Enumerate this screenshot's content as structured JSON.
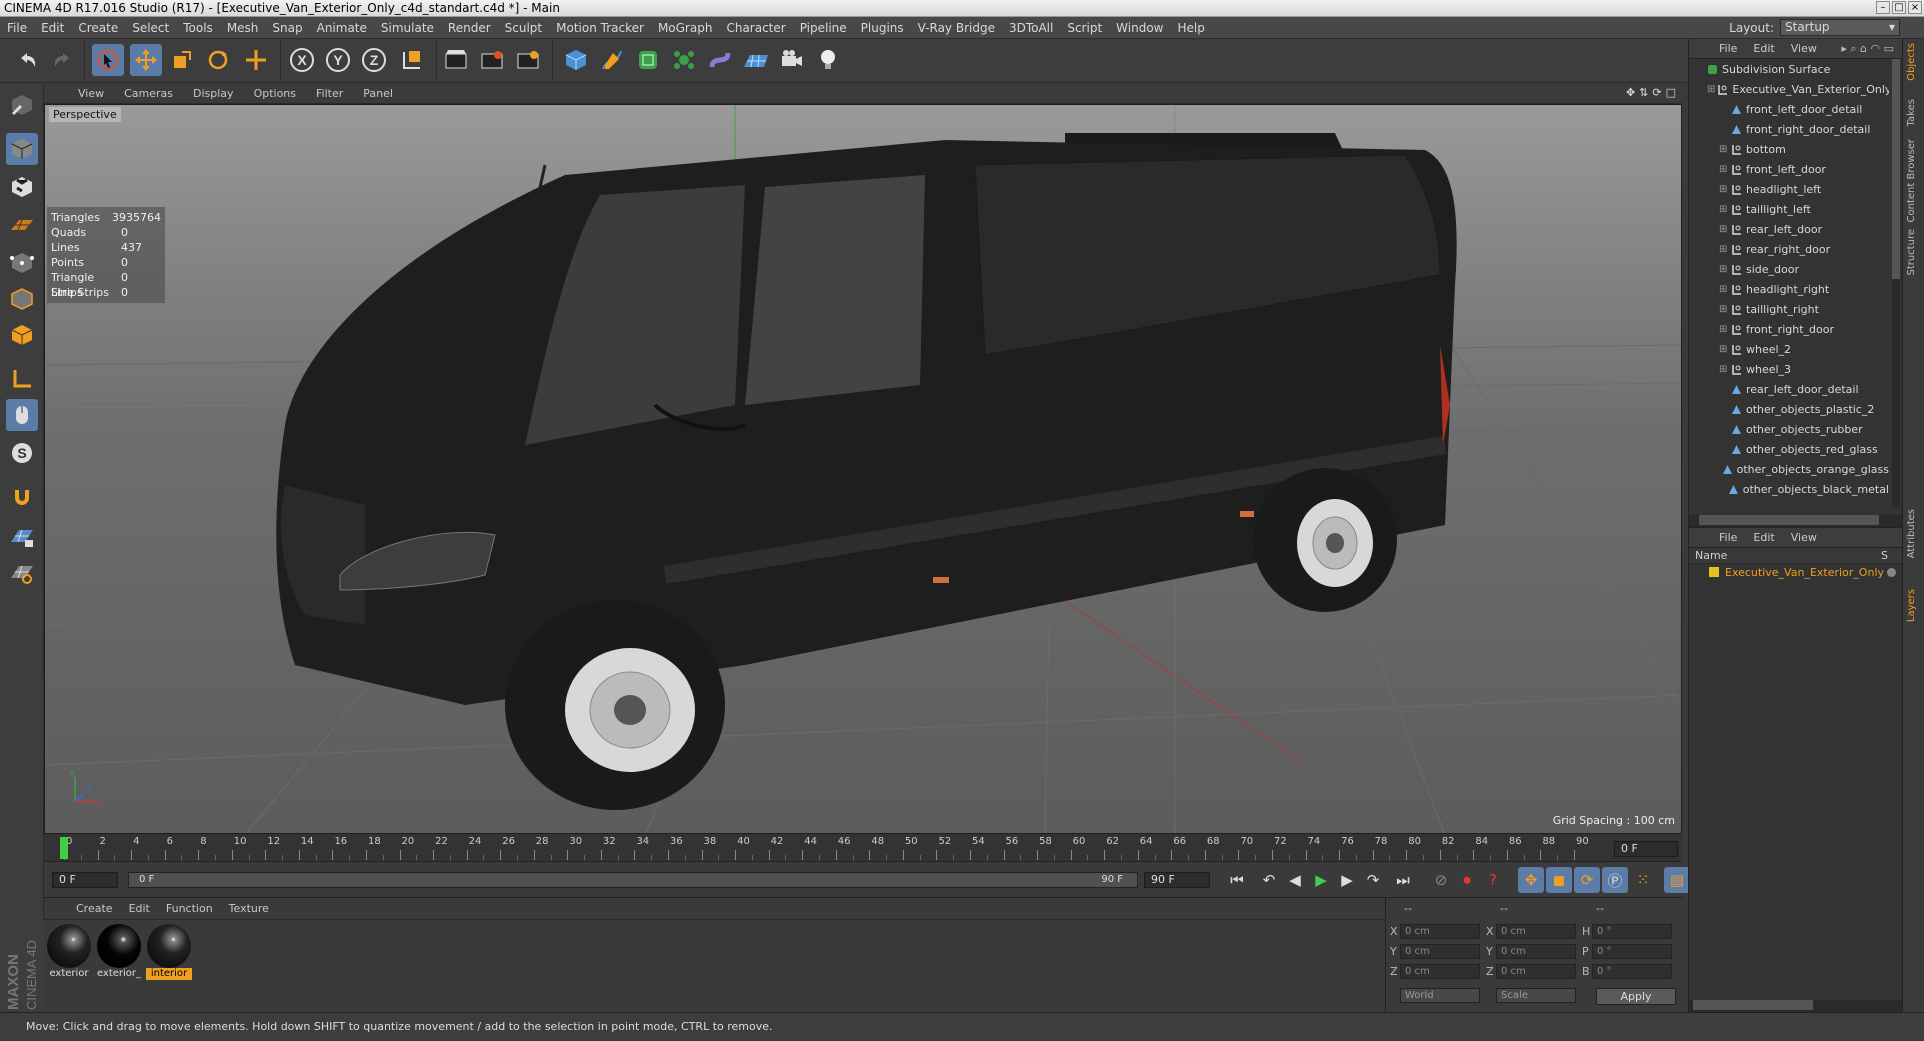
{
  "window": {
    "title": "CINEMA 4D R17.016 Studio (R17) - [Executive_Van_Exterior_Only_c4d_standart.c4d *] - Main"
  },
  "menu": [
    "File",
    "Edit",
    "Create",
    "Select",
    "Tools",
    "Mesh",
    "Snap",
    "Animate",
    "Simulate",
    "Render",
    "Sculpt",
    "Motion Tracker",
    "MoGraph",
    "Character",
    "Pipeline",
    "Plugins",
    "V-Ray Bridge",
    "3DToAll",
    "Script",
    "Window",
    "Help"
  ],
  "layout": {
    "label": "Layout:",
    "value": "Startup"
  },
  "toolbar": {
    "icons": [
      "undo-icon",
      "redo-icon",
      "select-icon",
      "move-icon",
      "scale-icon",
      "rotate-icon",
      "recent-tool-icon",
      "x-axis-icon",
      "y-axis-icon",
      "z-axis-icon",
      "coordinate-system-icon",
      "render-view-icon",
      "render-picture-viewer-icon",
      "edit-render-settings-icon",
      "cube-icon",
      "pen-icon",
      "subdivision-icon",
      "cloner-icon",
      "deformer-icon",
      "floor-icon",
      "camera-icon",
      "light-icon"
    ],
    "x_label": "X",
    "y_label": "Y",
    "z_label": "Z"
  },
  "viewport": {
    "menu": [
      "View",
      "Cameras",
      "Display",
      "Options",
      "Filter",
      "Panel"
    ],
    "label": "Perspective",
    "stats": [
      {
        "k": "Triangles",
        "v": "3935764"
      },
      {
        "k": "Quads",
        "v": "0"
      },
      {
        "k": "Lines",
        "v": "437"
      },
      {
        "k": "Points",
        "v": "0"
      },
      {
        "k": "Triangle Strips",
        "v": "0"
      },
      {
        "k": "Line Strips",
        "v": "0"
      }
    ],
    "grid_spacing": "Grid Spacing : 100 cm",
    "axis": {
      "x": "X",
      "y": "Y",
      "z": "Z"
    }
  },
  "timeline": {
    "ticks": [
      "0",
      "2",
      "4",
      "6",
      "8",
      "10",
      "12",
      "14",
      "16",
      "18",
      "20",
      "22",
      "24",
      "26",
      "28",
      "30",
      "32",
      "34",
      "36",
      "38",
      "40",
      "42",
      "44",
      "46",
      "48",
      "50",
      "52",
      "54",
      "56",
      "58",
      "60",
      "62",
      "64",
      "66",
      "68",
      "70",
      "72",
      "74",
      "76",
      "78",
      "80",
      "82",
      "84",
      "86",
      "88",
      "90"
    ],
    "current_frame": "0 F",
    "start": "0 F",
    "range_start": "0 F",
    "range_end": "90 F",
    "end": "90 F",
    "playhead_fraction": 0
  },
  "materials": {
    "menu": [
      "Create",
      "Edit",
      "Function",
      "Texture"
    ],
    "items": [
      {
        "label": "exterior",
        "selected": false
      },
      {
        "label": "exterior_",
        "selected": false
      },
      {
        "label": "interior",
        "selected": true
      }
    ]
  },
  "coordinates": {
    "headers": [
      "--",
      "--",
      "--"
    ],
    "rows": [
      {
        "axis": "X",
        "pos": "0 cm",
        "axis2": "X",
        "size": "0 cm",
        "rl": "H",
        "rot": "0 °"
      },
      {
        "axis": "Y",
        "pos": "0 cm",
        "axis2": "Y",
        "size": "0 cm",
        "rl": "P",
        "rot": "0 °"
      },
      {
        "axis": "Z",
        "pos": "0 cm",
        "axis2": "Z",
        "size": "0 cm",
        "rl": "B",
        "rot": "0 °"
      }
    ],
    "mode1": "World",
    "mode2": "Scale",
    "apply": "Apply"
  },
  "objects": {
    "menu": [
      "File",
      "Edit",
      "View"
    ],
    "tree": [
      {
        "name": "Subdivision Surface",
        "level": 0,
        "type": "subdiv"
      },
      {
        "name": "Executive_Van_Exterior_Only",
        "level": 1,
        "type": "null"
      },
      {
        "name": "front_left_door_detail",
        "level": 2,
        "type": "poly"
      },
      {
        "name": "front_right_door_detail",
        "level": 2,
        "type": "poly"
      },
      {
        "name": "bottom",
        "level": 2,
        "type": "null"
      },
      {
        "name": "front_left_door",
        "level": 2,
        "type": "null"
      },
      {
        "name": "headlight_left",
        "level": 2,
        "type": "null"
      },
      {
        "name": "taillight_left",
        "level": 2,
        "type": "null"
      },
      {
        "name": "rear_left_door",
        "level": 2,
        "type": "null"
      },
      {
        "name": "rear_right_door",
        "level": 2,
        "type": "null"
      },
      {
        "name": "side_door",
        "level": 2,
        "type": "null"
      },
      {
        "name": "headlight_right",
        "level": 2,
        "type": "null"
      },
      {
        "name": "taillight_right",
        "level": 2,
        "type": "null"
      },
      {
        "name": "front_right_door",
        "level": 2,
        "type": "null"
      },
      {
        "name": "wheel_2",
        "level": 2,
        "type": "null"
      },
      {
        "name": "wheel_3",
        "level": 2,
        "type": "null"
      },
      {
        "name": "rear_left_door_detail",
        "level": 2,
        "type": "poly"
      },
      {
        "name": "other_objects_plastic_2",
        "level": 2,
        "type": "poly"
      },
      {
        "name": "other_objects_rubber",
        "level": 2,
        "type": "poly"
      },
      {
        "name": "other_objects_red_glass",
        "level": 2,
        "type": "poly"
      },
      {
        "name": "other_objects_orange_glass",
        "level": 2,
        "type": "poly"
      },
      {
        "name": "other_objects_black_metal",
        "level": 2,
        "type": "poly"
      }
    ]
  },
  "layers": {
    "menu": [
      "File",
      "Edit",
      "View"
    ],
    "header_name": "Name",
    "header_s": "S",
    "items": [
      {
        "name": "Executive_Van_Exterior_Only",
        "color": "#e8c020"
      }
    ]
  },
  "side_tabs": [
    {
      "label": "Objects",
      "on": true
    },
    {
      "label": "Takes",
      "on": false
    },
    {
      "label": "Content Browser",
      "on": false
    },
    {
      "label": "Structure",
      "on": false
    },
    {
      "label": "Attributes",
      "on": false
    },
    {
      "label": "Layers",
      "on": true
    }
  ],
  "status": "Move: Click and drag to move elements. Hold down SHIFT to quantize movement / add to the selection in point mode, CTRL to remove.",
  "brand": "MAXON CINEMA 4D",
  "colors": {
    "accent": "#5b7ca8",
    "selection": "#f0a020",
    "bg": "#3a3a3a"
  }
}
